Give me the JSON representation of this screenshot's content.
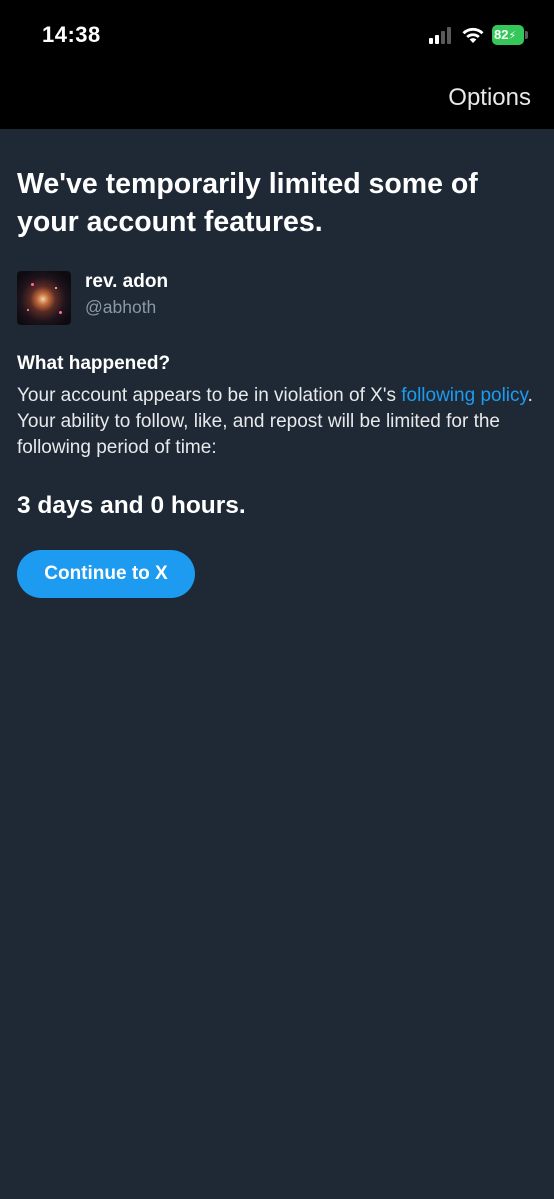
{
  "status_bar": {
    "time": "14:38",
    "battery_level": "82",
    "battery_color": "#34c759",
    "icons": [
      "cellular-signal-icon",
      "wifi-icon",
      "battery-charging-icon"
    ]
  },
  "navbar": {
    "options_label": "Options"
  },
  "notice": {
    "headline": "We've temporarily limited some of your account features.",
    "user": {
      "display_name": "rev. adon",
      "handle": "@abhoth"
    },
    "section_title": "What happened?",
    "body_before_link": "Your account appears to be in violation of X's ",
    "link_text": "following policy",
    "body_after_link": ". Your ability to follow, like, and repost will be limited for the following period of time:",
    "duration": "3 days and 0 hours.",
    "continue_label": "Continue to X"
  },
  "colors": {
    "background": "#1e2935",
    "bar_background": "#000000",
    "accent": "#1d9bf0",
    "secondary_text": "#8b98a5"
  }
}
